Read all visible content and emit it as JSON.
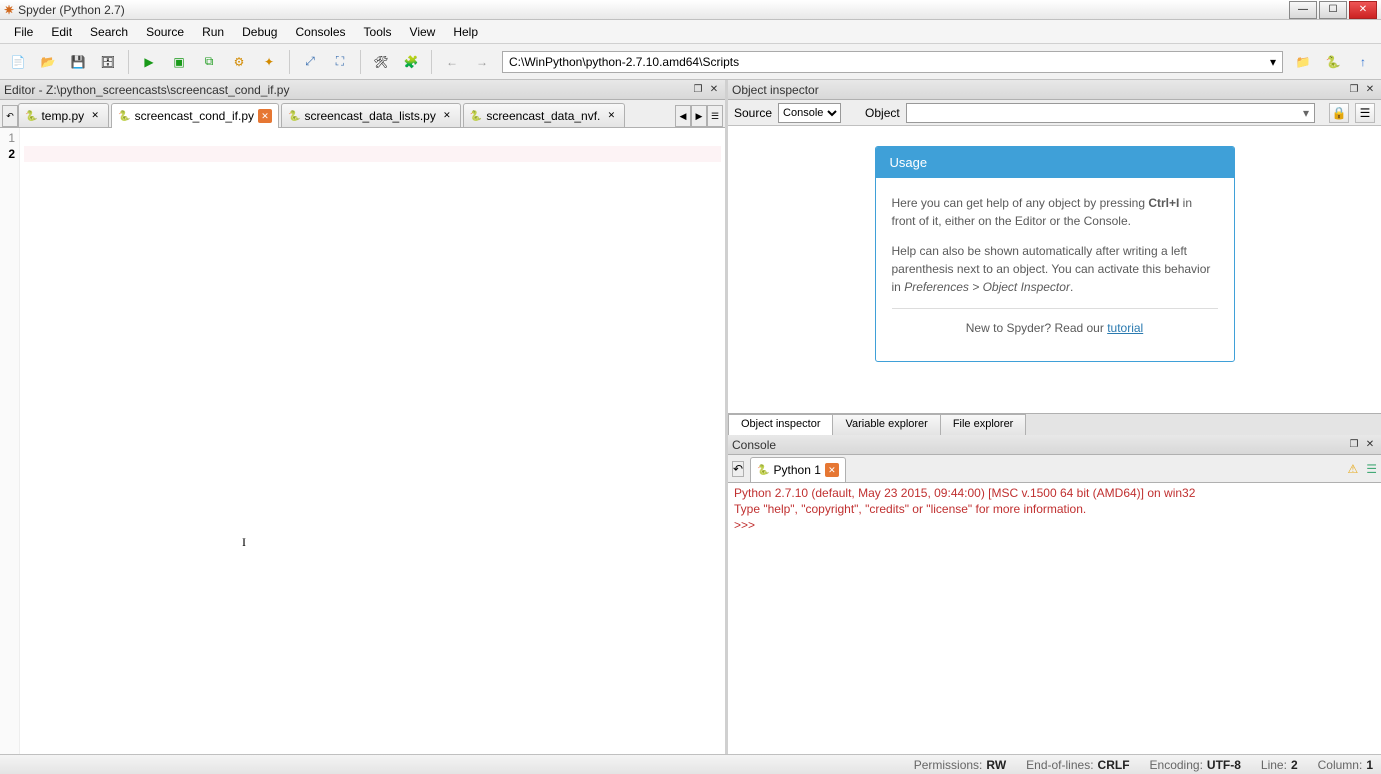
{
  "window": {
    "title": "Spyder (Python 2.7)"
  },
  "menu": [
    "File",
    "Edit",
    "Search",
    "Source",
    "Run",
    "Debug",
    "Consoles",
    "Tools",
    "View",
    "Help"
  ],
  "toolbar": {
    "path": "C:\\WinPython\\python-2.7.10.amd64\\Scripts",
    "icons": [
      "new-file-icon",
      "open-file-icon",
      "save-icon",
      "save-all-icon",
      "run-icon",
      "run-cell-icon",
      "run-cell-advance-icon",
      "run-selection-icon",
      "debug-icon",
      "maximize-icon",
      "fullscreen-icon",
      "preferences-icon",
      "python-path-icon",
      "back-icon",
      "forward-icon",
      "folder-icon",
      "python-icon",
      "up-icon"
    ]
  },
  "editor": {
    "pane_title": "Editor - Z:\\python_screencasts\\screencast_cond_if.py",
    "tabs": [
      {
        "label": "temp.py",
        "modified": false,
        "active": false
      },
      {
        "label": "screencast_cond_if.py",
        "modified": true,
        "active": true
      },
      {
        "label": "screencast_data_lists.py",
        "modified": false,
        "active": false
      },
      {
        "label": "screencast_data_nvf.",
        "modified": false,
        "active": false
      }
    ],
    "gutter": [
      "1",
      "2"
    ]
  },
  "inspector": {
    "pane_title": "Object inspector",
    "source_label": "Source",
    "source_value": "Console",
    "object_label": "Object",
    "usage": {
      "header": "Usage",
      "p1a": "Here you can get help of any object by pressing ",
      "p1_kbd": "Ctrl+I",
      "p1b": " in front of it, either on the Editor or the Console.",
      "p2a": "Help can also be shown automatically after writing a left parenthesis next to an object. You can activate this behavior in ",
      "p2_em": "Preferences > Object Inspector",
      "p2b": ".",
      "p3a": "New to Spyder? Read our ",
      "p3_link": "tutorial"
    },
    "bottom_tabs": [
      "Object inspector",
      "Variable explorer",
      "File explorer"
    ]
  },
  "console": {
    "pane_title": "Console",
    "tab": "Python 1",
    "lines": [
      "Python 2.7.10 (default, May 23 2015, 09:44:00) [MSC v.1500 64 bit (AMD64)] on win32",
      "Type \"help\", \"copyright\", \"credits\" or \"license\" for more information.",
      ">>> "
    ]
  },
  "status": {
    "permissions_label": "Permissions:",
    "permissions": "RW",
    "eol_label": "End-of-lines:",
    "eol": "CRLF",
    "encoding_label": "Encoding:",
    "encoding": "UTF-8",
    "line_label": "Line:",
    "line": "2",
    "column_label": "Column:",
    "column": "1"
  }
}
